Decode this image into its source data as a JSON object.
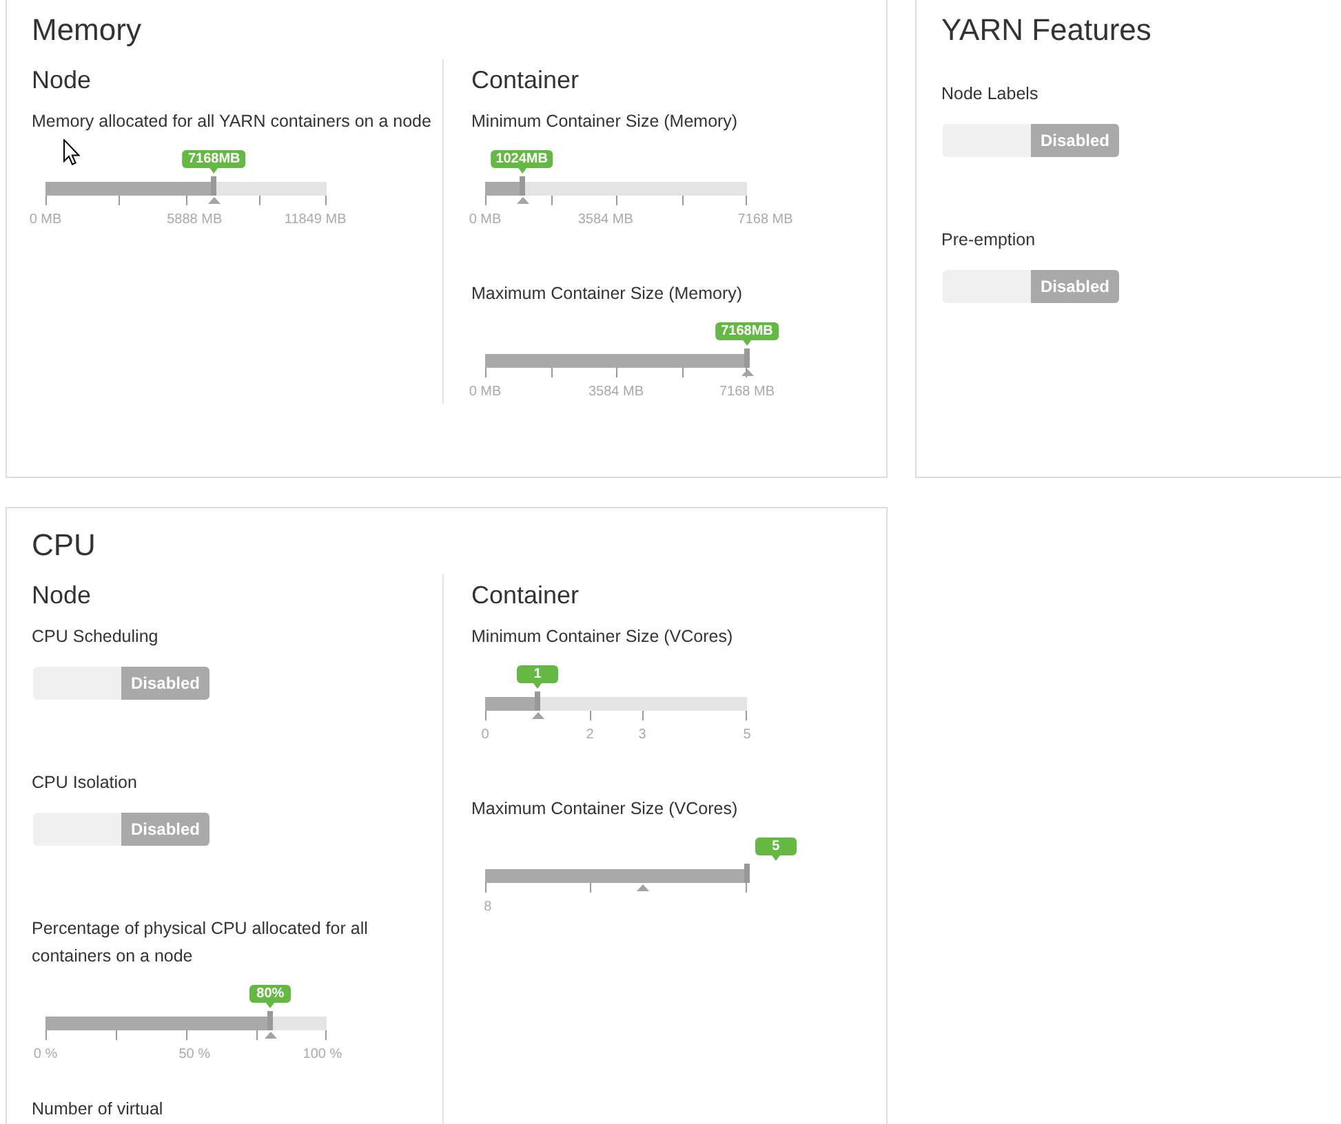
{
  "memory": {
    "title": "Memory",
    "columns": [
      {
        "heading": "Node",
        "settings": [
          {
            "kind": "slider",
            "label": "Memory allocated for all YARN containers on a node",
            "value": "7168MB",
            "level": 0.6,
            "ticks": [
              "0 MB",
              "5888 MB",
              "11849 MB"
            ]
          }
        ]
      },
      {
        "heading": "Container",
        "settings": [
          {
            "kind": "slider",
            "label": "Minimum Container Size (Memory)",
            "value": "1024MB",
            "level": 0.14,
            "ticks": [
              "0 MB",
              "3584 MB",
              "7168 MB"
            ]
          },
          {
            "kind": "slider",
            "label": "Maximum Container Size (Memory)",
            "value": "7168MB",
            "level": 1,
            "ticks": [
              "0 MB",
              "3584 MB",
              "7168 MB"
            ]
          }
        ]
      }
    ]
  },
  "yarn_features": {
    "title": "YARN Features",
    "settings": [
      {
        "kind": "toggle",
        "label": "Node Labels",
        "on": false,
        "state_label": "Disabled"
      },
      {
        "kind": "toggle",
        "label": "Pre-emption",
        "on": false,
        "state_label": "Disabled"
      }
    ]
  },
  "cpu": {
    "title": "CPU",
    "columns": [
      {
        "heading": "Node",
        "settings": [
          {
            "kind": "toggle",
            "label": "CPU Scheduling",
            "on": false,
            "state_label": "Disabled"
          },
          {
            "kind": "toggle",
            "label": "CPU Isolation",
            "on": false,
            "state_label": "Disabled"
          },
          {
            "kind": "slider",
            "label": "Percentage of physical CPU allocated for all containers on a node",
            "value": "80%",
            "level": 0.8,
            "ticks": [
              "0 %",
              "50 %",
              "100 %"
            ]
          },
          {
            "kind": "label",
            "label": "Number of virtual"
          }
        ]
      },
      {
        "heading": "Container",
        "settings": [
          {
            "kind": "slider",
            "label": "Minimum Container Size (VCores)",
            "value": "1",
            "level": 0.2,
            "ticks": [
              "0",
              "2",
              "3",
              "5"
            ]
          },
          {
            "kind": "slider",
            "label": "Maximum Container Size (VCores)",
            "value": "5",
            "level": 1,
            "ticks": [
              "8"
            ]
          }
        ]
      }
    ]
  }
}
